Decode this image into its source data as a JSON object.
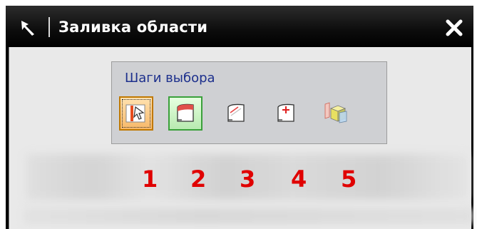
{
  "window": {
    "title": "Заливка области"
  },
  "selection_steps": {
    "label": "Шаги выбора",
    "buttons": [
      {
        "icon": "face-select-icon",
        "active": true
      },
      {
        "icon": "sheet-red-top-icon",
        "active": false
      },
      {
        "icon": "sheet-diagonal-icon",
        "active": false
      },
      {
        "icon": "sheet-plus-icon",
        "active": false
      },
      {
        "icon": "blocks-with-plane-icon",
        "active": false
      }
    ]
  },
  "annotations": [
    "1",
    "2",
    "3",
    "4",
    "5"
  ],
  "colors": {
    "titlebar": "#000000",
    "label_text": "#1c2f8c",
    "annotation_red": "#e00000",
    "active_orange": "#f7b869",
    "active_green": "#b8eab0"
  }
}
